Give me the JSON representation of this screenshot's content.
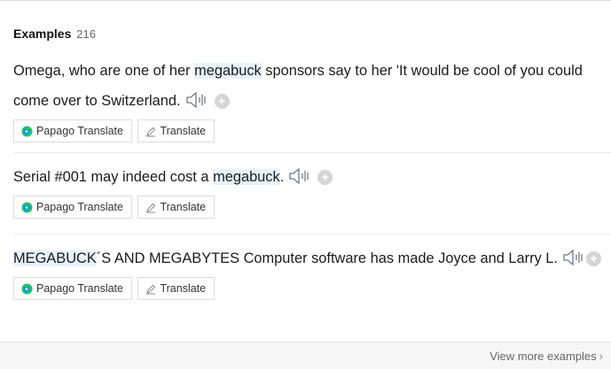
{
  "examples_header": {
    "title": "Examples",
    "count": "216"
  },
  "examples": [
    {
      "parts": [
        "Omega, who are one of her ",
        "megabuck",
        " sponsors say to her 'It would be cool of you could come over to Switzerland."
      ],
      "buttons": {
        "papago": "Papago Translate",
        "translate": "Translate"
      }
    },
    {
      "parts": [
        "Serial #001 may indeed cost a ",
        "megabuck",
        "."
      ],
      "buttons": {
        "papago": "Papago Translate",
        "translate": "Translate"
      }
    },
    {
      "parts": [
        "",
        "MEGABUCK",
        "´S AND MEGABYTES Computer software has made Joyce and Larry L."
      ],
      "buttons": {
        "papago": "Papago Translate",
        "translate": "Translate"
      }
    }
  ],
  "footer": {
    "view_more": "View more examples"
  },
  "icons": {
    "speaker": "speaker-icon",
    "add": "add-icon",
    "papago": "papago-logo-icon",
    "pencil": "pencil-icon",
    "chevron": "chevron-right-icon"
  },
  "colors": {
    "highlight": "#e7f3fd",
    "papago_green": "#1dc36a",
    "papago_blue": "#1b8ff0"
  }
}
